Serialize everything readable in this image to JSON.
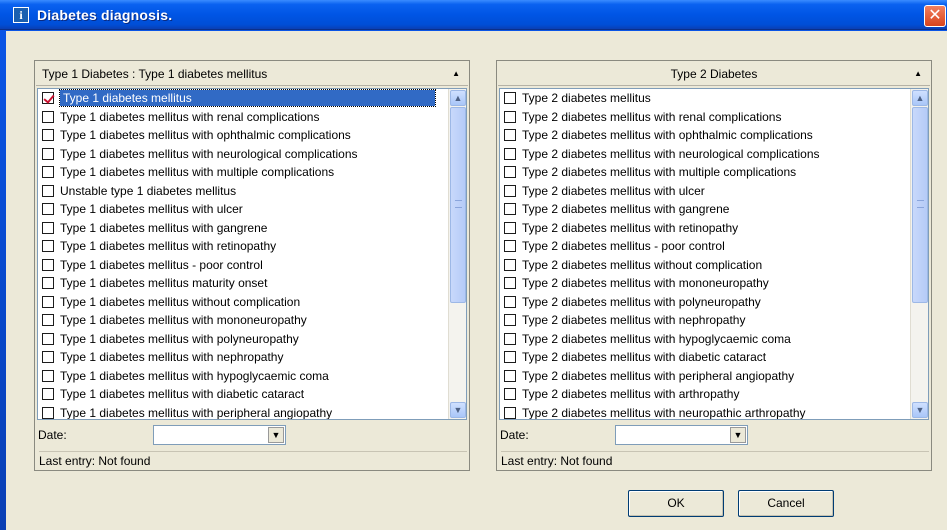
{
  "window": {
    "title": "Diabetes diagnosis.",
    "app_icon": "i",
    "close_glyph": "✕"
  },
  "left_panel": {
    "header": "Type 1 Diabetes : Type 1 diabetes mellitus",
    "sort_indicator": "▲",
    "items": [
      {
        "label": "Type 1 diabetes mellitus",
        "checked": true,
        "selected": true
      },
      {
        "label": "Type 1 diabetes mellitus with renal complications",
        "checked": false
      },
      {
        "label": "Type 1 diabetes mellitus with ophthalmic complications",
        "checked": false
      },
      {
        "label": "Type 1 diabetes mellitus with neurological complications",
        "checked": false
      },
      {
        "label": "Type 1 diabetes mellitus with multiple complications",
        "checked": false
      },
      {
        "label": "Unstable type 1 diabetes mellitus",
        "checked": false
      },
      {
        "label": "Type 1 diabetes mellitus with ulcer",
        "checked": false
      },
      {
        "label": "Type 1 diabetes mellitus with gangrene",
        "checked": false
      },
      {
        "label": "Type 1 diabetes mellitus with retinopathy",
        "checked": false
      },
      {
        "label": "Type 1 diabetes mellitus - poor control",
        "checked": false
      },
      {
        "label": "Type 1 diabetes mellitus maturity onset",
        "checked": false
      },
      {
        "label": "Type 1 diabetes mellitus without complication",
        "checked": false
      },
      {
        "label": "Type 1 diabetes mellitus with mononeuropathy",
        "checked": false
      },
      {
        "label": "Type 1 diabetes mellitus with polyneuropathy",
        "checked": false
      },
      {
        "label": "Type 1 diabetes mellitus with nephropathy",
        "checked": false
      },
      {
        "label": "Type 1 diabetes mellitus with hypoglycaemic coma",
        "checked": false
      },
      {
        "label": "Type 1 diabetes mellitus with diabetic cataract",
        "checked": false
      },
      {
        "label": "Type 1 diabetes mellitus with peripheral angiopathy",
        "checked": false
      }
    ],
    "date_label": "Date:",
    "date_value": "",
    "last_entry": "Last entry: Not found"
  },
  "right_panel": {
    "header": "Type 2 Diabetes",
    "sort_indicator": "▲",
    "items": [
      {
        "label": "Type 2 diabetes mellitus",
        "checked": false
      },
      {
        "label": "Type 2 diabetes mellitus with renal complications",
        "checked": false
      },
      {
        "label": "Type 2 diabetes mellitus with ophthalmic complications",
        "checked": false
      },
      {
        "label": "Type 2 diabetes mellitus with neurological complications",
        "checked": false
      },
      {
        "label": "Type 2 diabetes mellitus with multiple complications",
        "checked": false
      },
      {
        "label": "Type 2 diabetes mellitus with ulcer",
        "checked": false
      },
      {
        "label": "Type 2 diabetes mellitus with gangrene",
        "checked": false
      },
      {
        "label": "Type 2 diabetes mellitus with retinopathy",
        "checked": false
      },
      {
        "label": "Type 2 diabetes mellitus - poor control",
        "checked": false
      },
      {
        "label": "Type 2 diabetes mellitus without complication",
        "checked": false
      },
      {
        "label": "Type 2 diabetes mellitus with mononeuropathy",
        "checked": false
      },
      {
        "label": "Type 2 diabetes mellitus with polyneuropathy",
        "checked": false
      },
      {
        "label": "Type 2 diabetes mellitus with nephropathy",
        "checked": false
      },
      {
        "label": "Type 2 diabetes mellitus with hypoglycaemic coma",
        "checked": false
      },
      {
        "label": "Type 2 diabetes mellitus with diabetic cataract",
        "checked": false
      },
      {
        "label": "Type 2 diabetes mellitus with peripheral angiopathy",
        "checked": false
      },
      {
        "label": "Type 2 diabetes mellitus with arthropathy",
        "checked": false
      },
      {
        "label": "Type 2 diabetes mellitus with neuropathic arthropathy",
        "checked": false
      }
    ],
    "date_label": "Date:",
    "date_value": "",
    "last_entry": "Last entry: Not found"
  },
  "buttons": {
    "ok": "OK",
    "cancel": "Cancel"
  },
  "icons": {
    "scroll_up": "▲",
    "scroll_down": "▼",
    "dropdown": "▼"
  },
  "colors": {
    "titlebar": "#0055e5",
    "selection": "#316ac5",
    "client_bg": "#ece9d8",
    "close_button": "#d9431b"
  }
}
